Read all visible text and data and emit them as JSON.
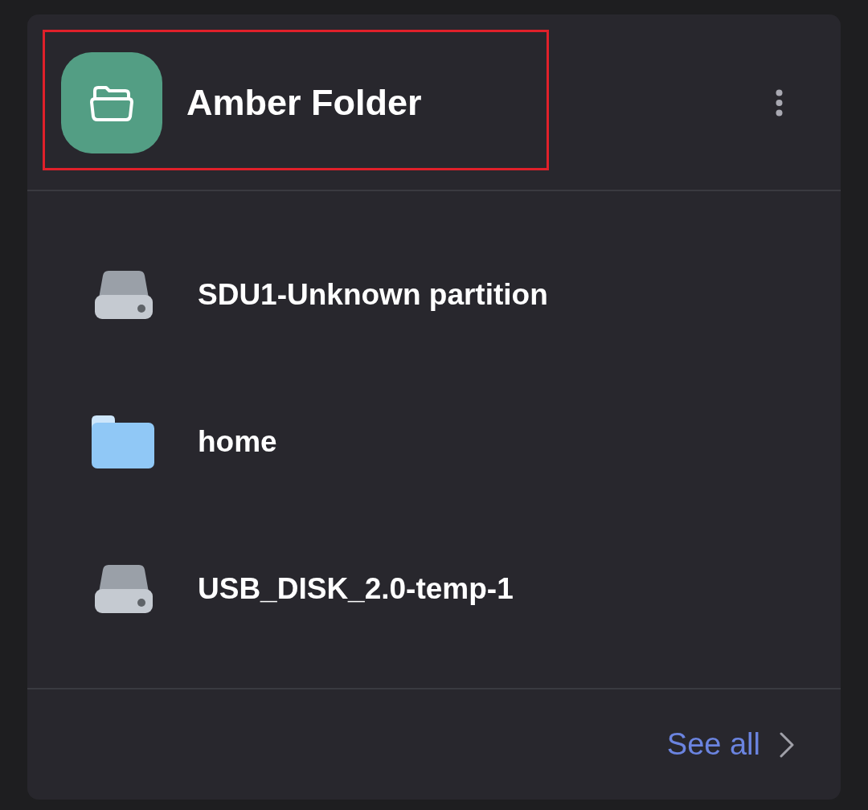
{
  "header": {
    "title": "Amber Folder",
    "highlighted": true
  },
  "items": [
    {
      "kind": "drive",
      "label": "SDU1-Unknown partition"
    },
    {
      "kind": "folder",
      "label": "home"
    },
    {
      "kind": "drive",
      "label": "USB_DISK_2.0-temp-1"
    }
  ],
  "footer": {
    "link": "See all"
  }
}
